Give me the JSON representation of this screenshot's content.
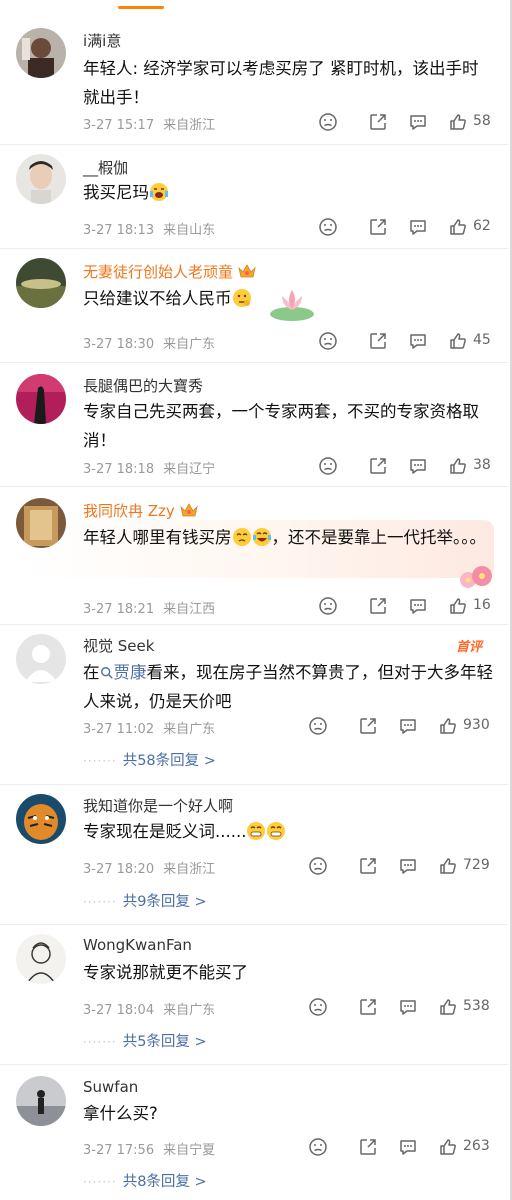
{
  "comments": [
    {
      "name": "i满i意",
      "name_style": "normal",
      "text": "年轻人: 经济学家可以考虑买房了 紧盯时机，该出手时就出手！",
      "date": "3-27 15:17",
      "location": "来自浙江",
      "likes": "58"
    },
    {
      "name": "__椵伽",
      "name_style": "normal",
      "text": "我买尼玛",
      "date": "3-27 18:13",
      "location": "来自山东",
      "likes": "62"
    },
    {
      "name": "无妻徒行创始人老顽童",
      "name_style": "orange",
      "text": "只给建议不给人民币",
      "date": "3-27 18:30",
      "location": "来自广东",
      "likes": "45"
    },
    {
      "name": "長腿偶巴的大寶秀",
      "name_style": "normal",
      "text": "专家自己先买两套，一个专家两套，不买的专家资格取消！",
      "date": "3-27 18:18",
      "location": "来自辽宁",
      "likes": "38"
    },
    {
      "name": "我同欣冉 Zzy",
      "name_style": "orange",
      "text_a": "年轻人哪里有钱买房",
      "text_b": "，还不是要靠上一代托举。。。",
      "date": "3-27 18:21",
      "location": "来自江西",
      "likes": "16"
    },
    {
      "name": "视觉 Seek",
      "name_style": "normal",
      "hot_label": "首评",
      "text_prefix": "在",
      "mention": "贾康",
      "text_suffix": "看来，现在房子当然不算贵了，但对于大多年轻人来说，仍是天价吧",
      "date": "3-27 11:02",
      "location": "来自广东",
      "likes": "930",
      "replies": "共58条回复 >"
    },
    {
      "name": "我知道你是一个好人啊",
      "name_style": "normal",
      "text": "专家现在是贬义词......",
      "date": "3-27 18:20",
      "location": "来自浙江",
      "likes": "729",
      "replies": "共9条回复 >"
    },
    {
      "name": "WongKwanFan",
      "name_style": "normal",
      "text": "专家说那就更不能买了",
      "date": "3-27 18:04",
      "location": "来自广东",
      "likes": "538",
      "replies": "共5条回复 >"
    },
    {
      "name": "Suwfan",
      "name_style": "normal",
      "text": "拿什么买?",
      "date": "3-27 17:56",
      "location": "来自宁夏",
      "likes": "263",
      "replies": "共8条回复 >"
    }
  ],
  "icons": {
    "dislike": "dislike-icon",
    "share": "share-icon",
    "comment": "comment-icon",
    "like": "thumbs-up-icon"
  },
  "colors": {
    "accent": "#ff8200",
    "vip_name": "#f0771b",
    "link": "#4a6fa5",
    "meta": "#9a9a9a"
  }
}
